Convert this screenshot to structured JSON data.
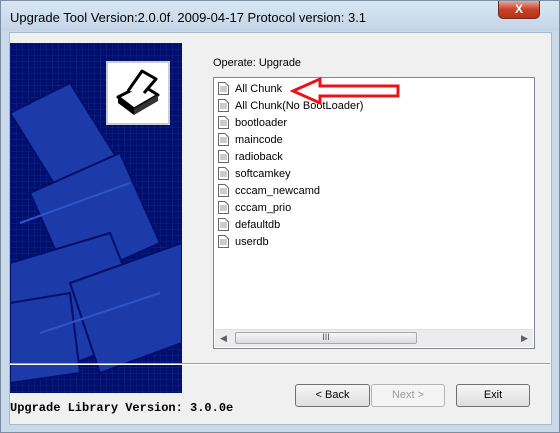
{
  "window": {
    "title": "Upgrade Tool Version:2.0.0f. 2009-04-17 Protocol version: 3.1",
    "close_label": "X"
  },
  "operate_label": "Operate: Upgrade",
  "list": {
    "items": [
      {
        "label": "All Chunk"
      },
      {
        "label": "All Chunk(No BootLoader)"
      },
      {
        "label": "bootloader"
      },
      {
        "label": "maincode"
      },
      {
        "label": "radioback"
      },
      {
        "label": "softcamkey"
      },
      {
        "label": "cccam_newcamd"
      },
      {
        "label": "cccam_prio"
      },
      {
        "label": "defaultdb"
      },
      {
        "label": "userdb"
      }
    ],
    "thumb_grip": "III"
  },
  "buttons": {
    "back": "< Back",
    "next": "Next >",
    "exit": "Exit"
  },
  "footer": "Upgrade Library Version: 3.0.0e",
  "colors": {
    "banner": "#000f6d",
    "annotation_arrow": "#e8141c"
  }
}
